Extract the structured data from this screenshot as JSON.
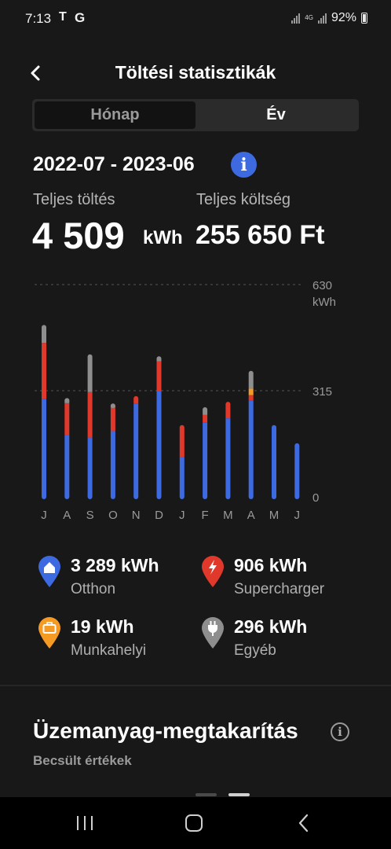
{
  "status_bar": {
    "time": "7:13",
    "tesla_symbol": "T",
    "google_letter": "G",
    "network": "4G",
    "battery": "92%"
  },
  "header": {
    "title": "Töltési statisztikák",
    "back_icon": "chevron-left-icon"
  },
  "tabs": [
    {
      "label": "Hónap",
      "selected": false
    },
    {
      "label": "Év",
      "selected": true
    }
  ],
  "period": "2022-07 - 2023-06",
  "summary": {
    "charging_label": "Teljes töltés",
    "charging_value": "4 509",
    "charging_unit": "kWh",
    "cost_label": "Teljes költség",
    "cost_value": "255 650 Ft"
  },
  "chart_data": {
    "type": "bar",
    "stacked": true,
    "categories": [
      "J",
      "A",
      "S",
      "O",
      "N",
      "D",
      "J",
      "F",
      "M",
      "A",
      "M",
      "J"
    ],
    "series": [
      {
        "key": "home",
        "color": "#3e6ae1",
        "values": [
          290,
          183,
          176,
          195,
          277,
          314,
          118,
          221,
          233,
          285,
          206,
          152
        ]
      },
      {
        "key": "supercharger",
        "color": "#e0392b",
        "values": [
          167,
          95,
          135,
          70,
          15,
          88,
          88,
          22,
          42,
          17,
          0,
          0
        ]
      },
      {
        "key": "work",
        "color": "#f59a23",
        "values": [
          0,
          0,
          0,
          0,
          0,
          0,
          0,
          0,
          0,
          19,
          0,
          0
        ]
      },
      {
        "key": "other",
        "color": "#8e8e8e",
        "values": [
          46,
          8,
          105,
          5,
          0,
          8,
          0,
          16,
          0,
          46,
          0,
          0
        ]
      }
    ],
    "ylim": [
      0,
      630
    ],
    "yticks": [
      "0",
      "315",
      "630"
    ],
    "ylabel": "kWh"
  },
  "legend": [
    {
      "icon": "home-icon",
      "value": "3 289 kWh",
      "label": "Otthon",
      "color": "#3e6ae1"
    },
    {
      "icon": "lightning-icon",
      "value": "906 kWh",
      "label": "Supercharger",
      "color": "#e0392b"
    },
    {
      "icon": "briefcase-icon",
      "value": "19 kWh",
      "label": "Munkahelyi",
      "color": "#f59a23"
    },
    {
      "icon": "plug-icon",
      "value": "296 kWh",
      "label": "Egyéb",
      "color": "#8e8e8e"
    }
  ],
  "fuel_savings": {
    "title": "Üzemanyag-megtakarítás",
    "subtitle": "Becsült értékek"
  },
  "nav": {
    "recents": "recents-icon",
    "home": "home-button-icon",
    "back": "back-icon"
  }
}
